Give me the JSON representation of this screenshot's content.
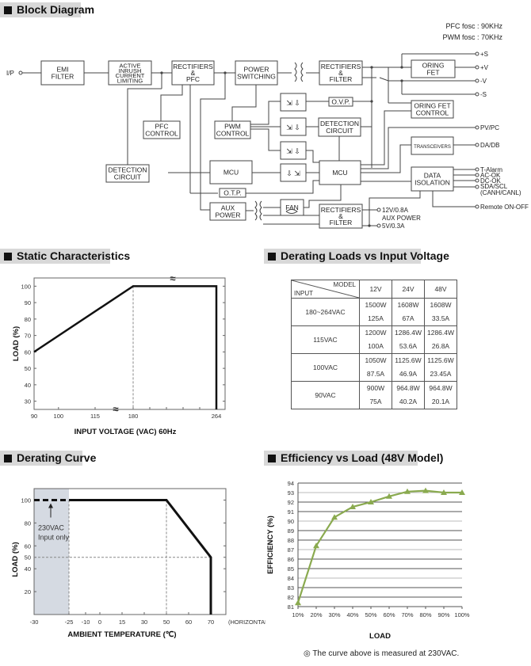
{
  "block_diagram": {
    "title": "Block Diagram",
    "freq_notes": [
      "PFC fosc : 90KHz",
      "PWM fosc : 70KHz"
    ],
    "blocks": {
      "emi": [
        "EMI",
        "FILTER"
      ],
      "inrush": [
        "ACTIVE",
        "INRUSH",
        "CURRENT",
        "LIMITING"
      ],
      "rect_pfc": [
        "RECTIFIERS",
        "&",
        "PFC"
      ],
      "power_sw": [
        "POWER",
        "SWITCHING"
      ],
      "rect_filter": [
        "RECTIFIERS",
        "&",
        "FILTER"
      ],
      "oring_fet": [
        "ORING",
        "FET"
      ],
      "oring_ctrl": [
        "ORING FET",
        "CONTROL"
      ],
      "pfc_ctrl": [
        "PFC",
        "CONTROL"
      ],
      "pwm_ctrl": [
        "PWM",
        "CONTROL"
      ],
      "ovp": [
        "O.V.P."
      ],
      "det_circ_right": [
        "DETECTION",
        "CIRCUIT"
      ],
      "det_circ_left": [
        "DETECTION",
        "CIRCUIT"
      ],
      "mcu_left": [
        "MCU"
      ],
      "mcu_right": [
        "MCU"
      ],
      "otp": [
        "O.T.P."
      ],
      "aux_power": [
        "AUX",
        "POWER"
      ],
      "fan": [
        "FAN"
      ],
      "rect_filter_aux": [
        "RECTIFIERS",
        "&",
        "FILTER"
      ],
      "transceivers": [
        "TRANSCEIVERS"
      ],
      "data_iso": [
        "DATA",
        "ISOLATION"
      ]
    },
    "terminals": {
      "input": "I/P",
      "plus_s": "+S",
      "plus_v": "+V",
      "minus_v": "-V",
      "minus_s": "-S",
      "pv_pc": "PV/PC",
      "da_db": "DA/DB",
      "t_alarm": "T-Alarm",
      "ac_ok": "AC-OK",
      "dc_ok": "DC-OK",
      "sda_scl": "SDA/SCL",
      "canh_canl": "(CANH/CANL)",
      "remote": "Remote ON-OFF",
      "aux_12v": "12V/0.8A",
      "aux_label": "AUX POWER",
      "aux_5v": "5V/0.3A"
    }
  },
  "static_chart": {
    "title": "Static Characteristics"
  },
  "derating_table": {
    "title": "Derating Loads vs Input Voltage",
    "corner_model": "MODEL",
    "corner_input": "INPUT",
    "models": [
      "12V",
      "24V",
      "48V"
    ],
    "rows": [
      {
        "input": "180~264VAC",
        "watts": [
          "1500W",
          "1608W",
          "1608W"
        ],
        "amps": [
          "125A",
          "67A",
          "33.5A"
        ]
      },
      {
        "input": "115VAC",
        "watts": [
          "1200W",
          "1286.4W",
          "1286.4W"
        ],
        "amps": [
          "100A",
          "53.6A",
          "26.8A"
        ]
      },
      {
        "input": "100VAC",
        "watts": [
          "1050W",
          "1125.6W",
          "1125.6W"
        ],
        "amps": [
          "87.5A",
          "46.9A",
          "23.45A"
        ]
      },
      {
        "input": "90VAC",
        "watts": [
          "900W",
          "964.8W",
          "964.8W"
        ],
        "amps": [
          "75A",
          "40.2A",
          "20.1A"
        ]
      }
    ]
  },
  "derating_curve": {
    "title": "Derating Curve",
    "annotation": [
      "230VAC",
      "Input only"
    ],
    "x_suffix": "(HORIZONTAL)"
  },
  "efficiency": {
    "title": "Efficiency vs Load (48V Model)",
    "note": "◎ The curve above is measured at 230VAC."
  },
  "chart_data": [
    {
      "type": "line",
      "name": "static-characteristics",
      "title": "Static Characteristics",
      "xlabel": "INPUT VOLTAGE (VAC) 60Hz",
      "ylabel": "LOAD (%)",
      "x_ticks": [
        "90",
        "100",
        "115",
        "180",
        "264"
      ],
      "y_ticks": [
        "30",
        "40",
        "50",
        "60",
        "70",
        "80",
        "90",
        "100"
      ],
      "ylim": [
        25,
        105
      ],
      "axis_break": true,
      "series": [
        {
          "name": "load",
          "x": [
            90,
            180,
            264,
            264
          ],
          "y": [
            60,
            100,
            100,
            25
          ]
        }
      ],
      "reference_lines": [
        {
          "x": 180,
          "style": "dashed"
        }
      ],
      "grid": false
    },
    {
      "type": "line",
      "name": "derating-curve",
      "title": "Derating Curve",
      "xlabel": "AMBIENT TEMPERATURE (℃)",
      "ylabel": "LOAD (%)",
      "x_ticks": [
        "-30",
        "-25",
        "-10",
        "0",
        "15",
        "30",
        "50",
        "60",
        "70"
      ],
      "y_ticks": [
        "20",
        "40",
        "50",
        "60",
        "80",
        "100"
      ],
      "ylim": [
        0,
        110
      ],
      "series": [
        {
          "name": "230VAC input only",
          "style": "dashed",
          "x": [
            -30,
            -25
          ],
          "y": [
            100,
            100
          ]
        },
        {
          "name": "load",
          "style": "solid",
          "x": [
            -25,
            50,
            70,
            70
          ],
          "y": [
            100,
            100,
            50,
            0
          ]
        }
      ],
      "shaded_region": {
        "x": [
          -30,
          -25
        ]
      },
      "reference_lines": [
        {
          "x": -25
        },
        {
          "x": 50
        },
        {
          "y": 50
        }
      ],
      "grid": false
    },
    {
      "type": "line",
      "name": "efficiency-vs-load",
      "title": "Efficiency vs Load (48V Model)",
      "xlabel": "LOAD",
      "ylabel": "EFFICIENCY (%)",
      "categories": [
        "10%",
        "20%",
        "30%",
        "40%",
        "50%",
        "60%",
        "70%",
        "80%",
        "90%",
        "100%"
      ],
      "y_ticks": [
        "81",
        "82",
        "83",
        "84",
        "85",
        "86",
        "87",
        "88",
        "89",
        "90",
        "91",
        "92",
        "93",
        "94"
      ],
      "ylim": [
        81,
        94
      ],
      "series": [
        {
          "name": "48V",
          "color": "#8aaa4f",
          "values": [
            81.4,
            87.4,
            90.4,
            91.5,
            92.0,
            92.6,
            93.1,
            93.2,
            93.0,
            93.0
          ]
        }
      ],
      "grid": true
    }
  ]
}
